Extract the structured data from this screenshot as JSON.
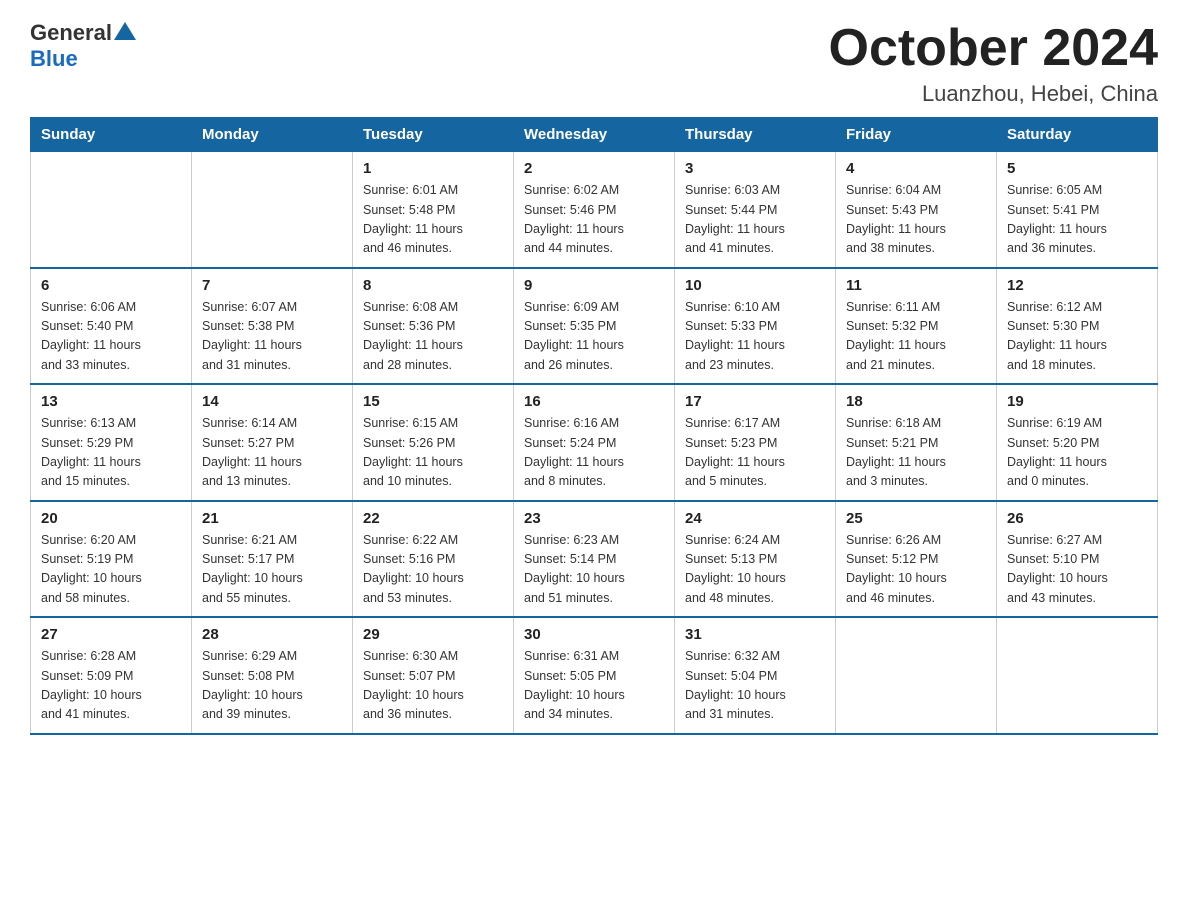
{
  "logo": {
    "general": "General",
    "blue": "Blue",
    "triangle": "▲"
  },
  "title": "October 2024",
  "subtitle": "Luanzhou, Hebei, China",
  "headers": [
    "Sunday",
    "Monday",
    "Tuesday",
    "Wednesday",
    "Thursday",
    "Friday",
    "Saturday"
  ],
  "weeks": [
    [
      {
        "day": "",
        "info": ""
      },
      {
        "day": "",
        "info": ""
      },
      {
        "day": "1",
        "info": "Sunrise: 6:01 AM\nSunset: 5:48 PM\nDaylight: 11 hours\nand 46 minutes."
      },
      {
        "day": "2",
        "info": "Sunrise: 6:02 AM\nSunset: 5:46 PM\nDaylight: 11 hours\nand 44 minutes."
      },
      {
        "day": "3",
        "info": "Sunrise: 6:03 AM\nSunset: 5:44 PM\nDaylight: 11 hours\nand 41 minutes."
      },
      {
        "day": "4",
        "info": "Sunrise: 6:04 AM\nSunset: 5:43 PM\nDaylight: 11 hours\nand 38 minutes."
      },
      {
        "day": "5",
        "info": "Sunrise: 6:05 AM\nSunset: 5:41 PM\nDaylight: 11 hours\nand 36 minutes."
      }
    ],
    [
      {
        "day": "6",
        "info": "Sunrise: 6:06 AM\nSunset: 5:40 PM\nDaylight: 11 hours\nand 33 minutes."
      },
      {
        "day": "7",
        "info": "Sunrise: 6:07 AM\nSunset: 5:38 PM\nDaylight: 11 hours\nand 31 minutes."
      },
      {
        "day": "8",
        "info": "Sunrise: 6:08 AM\nSunset: 5:36 PM\nDaylight: 11 hours\nand 28 minutes."
      },
      {
        "day": "9",
        "info": "Sunrise: 6:09 AM\nSunset: 5:35 PM\nDaylight: 11 hours\nand 26 minutes."
      },
      {
        "day": "10",
        "info": "Sunrise: 6:10 AM\nSunset: 5:33 PM\nDaylight: 11 hours\nand 23 minutes."
      },
      {
        "day": "11",
        "info": "Sunrise: 6:11 AM\nSunset: 5:32 PM\nDaylight: 11 hours\nand 21 minutes."
      },
      {
        "day": "12",
        "info": "Sunrise: 6:12 AM\nSunset: 5:30 PM\nDaylight: 11 hours\nand 18 minutes."
      }
    ],
    [
      {
        "day": "13",
        "info": "Sunrise: 6:13 AM\nSunset: 5:29 PM\nDaylight: 11 hours\nand 15 minutes."
      },
      {
        "day": "14",
        "info": "Sunrise: 6:14 AM\nSunset: 5:27 PM\nDaylight: 11 hours\nand 13 minutes."
      },
      {
        "day": "15",
        "info": "Sunrise: 6:15 AM\nSunset: 5:26 PM\nDaylight: 11 hours\nand 10 minutes."
      },
      {
        "day": "16",
        "info": "Sunrise: 6:16 AM\nSunset: 5:24 PM\nDaylight: 11 hours\nand 8 minutes."
      },
      {
        "day": "17",
        "info": "Sunrise: 6:17 AM\nSunset: 5:23 PM\nDaylight: 11 hours\nand 5 minutes."
      },
      {
        "day": "18",
        "info": "Sunrise: 6:18 AM\nSunset: 5:21 PM\nDaylight: 11 hours\nand 3 minutes."
      },
      {
        "day": "19",
        "info": "Sunrise: 6:19 AM\nSunset: 5:20 PM\nDaylight: 11 hours\nand 0 minutes."
      }
    ],
    [
      {
        "day": "20",
        "info": "Sunrise: 6:20 AM\nSunset: 5:19 PM\nDaylight: 10 hours\nand 58 minutes."
      },
      {
        "day": "21",
        "info": "Sunrise: 6:21 AM\nSunset: 5:17 PM\nDaylight: 10 hours\nand 55 minutes."
      },
      {
        "day": "22",
        "info": "Sunrise: 6:22 AM\nSunset: 5:16 PM\nDaylight: 10 hours\nand 53 minutes."
      },
      {
        "day": "23",
        "info": "Sunrise: 6:23 AM\nSunset: 5:14 PM\nDaylight: 10 hours\nand 51 minutes."
      },
      {
        "day": "24",
        "info": "Sunrise: 6:24 AM\nSunset: 5:13 PM\nDaylight: 10 hours\nand 48 minutes."
      },
      {
        "day": "25",
        "info": "Sunrise: 6:26 AM\nSunset: 5:12 PM\nDaylight: 10 hours\nand 46 minutes."
      },
      {
        "day": "26",
        "info": "Sunrise: 6:27 AM\nSunset: 5:10 PM\nDaylight: 10 hours\nand 43 minutes."
      }
    ],
    [
      {
        "day": "27",
        "info": "Sunrise: 6:28 AM\nSunset: 5:09 PM\nDaylight: 10 hours\nand 41 minutes."
      },
      {
        "day": "28",
        "info": "Sunrise: 6:29 AM\nSunset: 5:08 PM\nDaylight: 10 hours\nand 39 minutes."
      },
      {
        "day": "29",
        "info": "Sunrise: 6:30 AM\nSunset: 5:07 PM\nDaylight: 10 hours\nand 36 minutes."
      },
      {
        "day": "30",
        "info": "Sunrise: 6:31 AM\nSunset: 5:05 PM\nDaylight: 10 hours\nand 34 minutes."
      },
      {
        "day": "31",
        "info": "Sunrise: 6:32 AM\nSunset: 5:04 PM\nDaylight: 10 hours\nand 31 minutes."
      },
      {
        "day": "",
        "info": ""
      },
      {
        "day": "",
        "info": ""
      }
    ]
  ]
}
